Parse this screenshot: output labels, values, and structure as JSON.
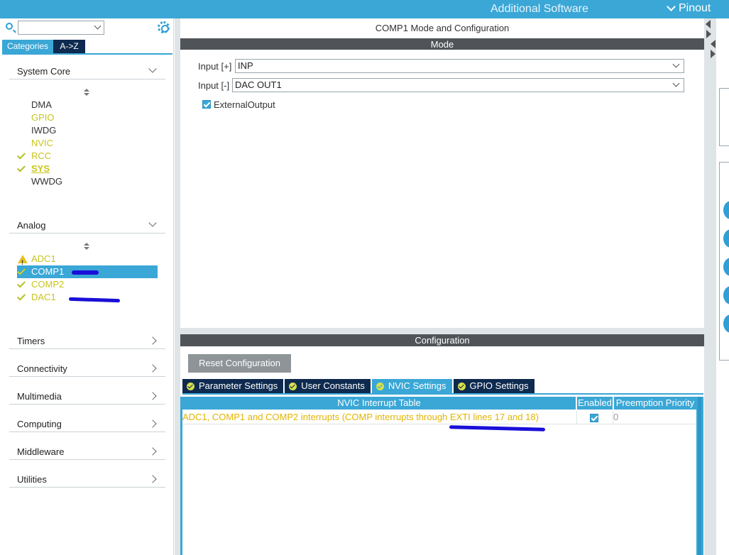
{
  "topbar": {
    "additional_software": "Additional Software",
    "pinout": "Pinout"
  },
  "left": {
    "search": {
      "value": "",
      "placeholder": ""
    },
    "tabs": {
      "categories": "Categories",
      "az": "A->Z"
    },
    "system_core": {
      "label": "System Core",
      "items": [
        {
          "label": "DMA",
          "status": "none"
        },
        {
          "label": "GPIO",
          "status": "none"
        },
        {
          "label": "IWDG",
          "status": "none"
        },
        {
          "label": "NVIC",
          "status": "none"
        },
        {
          "label": "RCC",
          "status": "ok"
        },
        {
          "label": "SYS",
          "status": "ok"
        },
        {
          "label": "WWDG",
          "status": "none"
        }
      ]
    },
    "analog": {
      "label": "Analog",
      "items": [
        {
          "label": "ADC1",
          "status": "warning"
        },
        {
          "label": "COMP1",
          "status": "ok",
          "selected": true
        },
        {
          "label": "COMP2",
          "status": "ok"
        },
        {
          "label": "DAC1",
          "status": "ok"
        }
      ]
    },
    "groups": [
      "Timers",
      "Connectivity",
      "Multimedia",
      "Computing",
      "Middleware",
      "Utilities"
    ]
  },
  "center": {
    "title": "COMP1 Mode and Configuration",
    "mode_bar": "Mode",
    "input_plus": {
      "label": "Input [+]",
      "value": "INP"
    },
    "input_minus": {
      "label": "Input [-]",
      "value": "DAC OUT1"
    },
    "external_output": {
      "label": "ExternalOutput",
      "checked": true
    },
    "config_bar": "Configuration",
    "reset_button": "Reset Configuration",
    "tabs": [
      "Parameter Settings",
      "User Constants",
      "NVIC Settings",
      "GPIO Settings"
    ],
    "active_tab": "NVIC Settings",
    "table": {
      "headers": [
        "NVIC Interrupt Table",
        "Enabled",
        "Preemption Priority"
      ],
      "rows": [
        {
          "name": "ADC1, COMP1 and COMP2 interrupts (COMP interrupts through EXTI lines 17 and 18)",
          "enabled": true,
          "priority": "0"
        }
      ]
    }
  },
  "colors": {
    "accent": "#3aa7d6",
    "dark_tab": "#0e2a4f",
    "ok_yellow": "#c8c51c",
    "bar_gray": "#505458",
    "annotation_blue": "#1a0fd8"
  }
}
